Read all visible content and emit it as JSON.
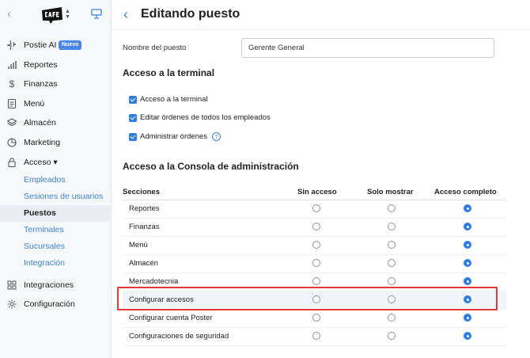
{
  "sidebar": {
    "badge": "Nuevo",
    "items": [
      {
        "label": "Postie AI",
        "icon": "sparkle-icon"
      },
      {
        "label": "Reportes",
        "icon": "bar-chart-icon"
      },
      {
        "label": "Finanzas",
        "icon": "dollar-icon"
      },
      {
        "label": "Menú",
        "icon": "document-icon"
      },
      {
        "label": "Almacén",
        "icon": "layers-icon"
      },
      {
        "label": "Marketing",
        "icon": "pie-chart-icon"
      },
      {
        "label": "Acceso ▾",
        "icon": "lock-icon"
      }
    ],
    "sub_items": [
      {
        "label": "Empleados"
      },
      {
        "label": "Sesiones de usuarios"
      },
      {
        "label": "Puestos"
      },
      {
        "label": "Terminales"
      },
      {
        "label": "Sucursales"
      },
      {
        "label": "Integración"
      }
    ],
    "bottom_items": [
      {
        "label": "Integraciones",
        "icon": "grid-icon"
      },
      {
        "label": "Configuración",
        "icon": "gear-icon"
      }
    ]
  },
  "page": {
    "title": "Editando puesto",
    "name_label": "Nombre del puesto",
    "name_value": "Gerente General"
  },
  "terminal_section": {
    "title": "Acceso a la terminal",
    "options": [
      {
        "label": "Acceso a la terminal",
        "checked": true
      },
      {
        "label": "Editar órdenes de todos los empleados",
        "checked": true
      },
      {
        "label": "Administrar órdenes",
        "checked": true
      }
    ]
  },
  "console_section": {
    "title": "Acceso a la Consola de administración",
    "headers": [
      "Secciones",
      "Sin acceso",
      "Solo mostrar",
      "Acceso completo"
    ],
    "rows": [
      {
        "label": "Reportes",
        "selected": "Acceso completo"
      },
      {
        "label": "Finanzas",
        "selected": "Acceso completo"
      },
      {
        "label": "Menú",
        "selected": "Acceso completo"
      },
      {
        "label": "Almacén",
        "selected": "Acceso completo"
      },
      {
        "label": "Mercadotecnia",
        "selected": "Acceso completo"
      },
      {
        "label": "Configurar accesos",
        "selected": "Acceso completo"
      },
      {
        "label": "Configurar cuenta Poster",
        "selected": "Acceso completo"
      },
      {
        "label": "Configuraciones de seguridad",
        "selected": "Acceso completo"
      }
    ]
  },
  "colors": {
    "accent": "#2f7de1",
    "highlight": "#e53935"
  }
}
